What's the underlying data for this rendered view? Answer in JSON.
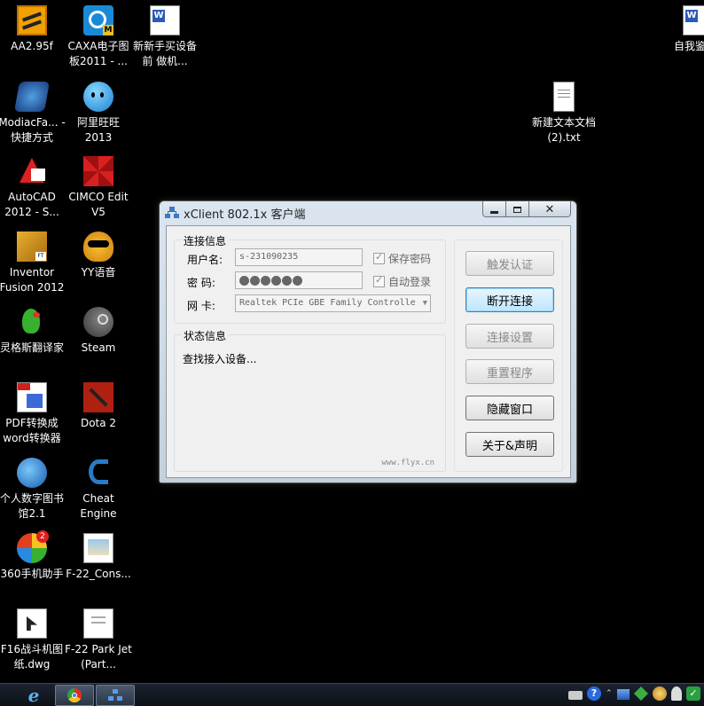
{
  "desktop": {
    "icons": [
      {
        "label": "AA2.95f"
      },
      {
        "label": "CAXA电子图板2011 - ..."
      },
      {
        "label": "新新手买设备前 做机..."
      },
      {
        "label": "ModiacFa... - 快捷方式"
      },
      {
        "label": "阿里旺旺 2013"
      },
      {
        "label": "AutoCAD 2012 - S..."
      },
      {
        "label": "CIMCO Edit V5"
      },
      {
        "label": "Inventor Fusion 2012"
      },
      {
        "label": "YY语音"
      },
      {
        "label": "灵格斯翻译家"
      },
      {
        "label": "Steam"
      },
      {
        "label": "PDF转换成word转换器"
      },
      {
        "label": "Dota 2"
      },
      {
        "label": "个人数字图书馆2.1"
      },
      {
        "label": "Cheat Engine"
      },
      {
        "label": "360手机助手"
      },
      {
        "label": "F-22_Cons..."
      },
      {
        "label": "F16战斗机图纸.dwg"
      },
      {
        "label": "F-22 Park Jet (Part..."
      },
      {
        "label": "新建文本文档 (2).txt"
      },
      {
        "label": "自我鉴 doc"
      }
    ]
  },
  "window": {
    "title": "xClient 802.1x 客户端",
    "connection_group": {
      "title": "连接信息",
      "username_label": "用户名:",
      "username_value": "s-231090235",
      "password_label": "密  码:",
      "nic_label": "网  卡:",
      "nic_value": "Realtek PCIe GBE Family Controlle",
      "save_password": "保存密码",
      "auto_login": "自动登录"
    },
    "status_group": {
      "title": "状态信息",
      "text": "查找接入设备...",
      "url": "www.flyx.cn"
    },
    "buttons": {
      "trigger_auth": "触发认证",
      "disconnect": "断开连接",
      "conn_settings": "连接设置",
      "reset": "重置程序",
      "hide": "隐藏窗口",
      "about": "关于&声明"
    }
  },
  "colors": {
    "desktop_bg": "#000000",
    "focus_button": "#bee6fd"
  }
}
